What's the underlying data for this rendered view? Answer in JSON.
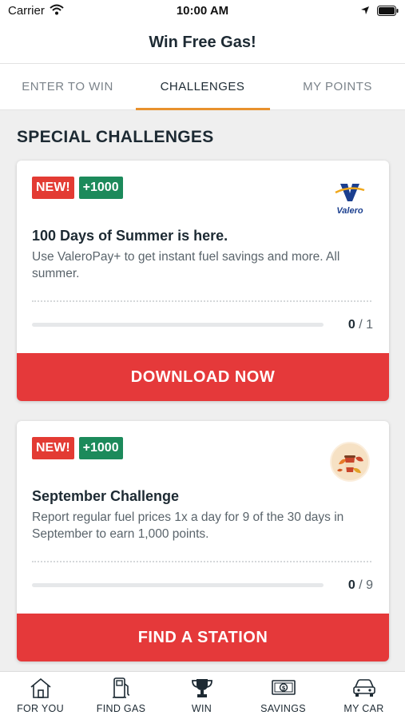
{
  "status_bar": {
    "carrier": "Carrier",
    "time": "10:00 AM"
  },
  "nav": {
    "title": "Win Free Gas!"
  },
  "tabs": [
    {
      "label": "ENTER TO WIN",
      "active": false
    },
    {
      "label": "CHALLENGES",
      "active": true
    },
    {
      "label": "MY POINTS",
      "active": false
    }
  ],
  "section": {
    "title": "SPECIAL CHALLENGES"
  },
  "challenges": [
    {
      "badge_new": "NEW!",
      "badge_points": "+1000",
      "logo_text": "Valero",
      "title": "100 Days of Summer is here.",
      "description": "Use ValeroPay+ to get instant fuel savings and more. All summer.",
      "progress_current": "0",
      "progress_total": "/ 1",
      "progress_fraction": 0,
      "cta_label": "DOWNLOAD NOW"
    },
    {
      "badge_new": "NEW!",
      "badge_points": "+1000",
      "title": "September Challenge",
      "description": "Report regular fuel prices 1x a day for 9 of the 30 days in September to earn 1,000 points.",
      "progress_current": "0",
      "progress_total": "/ 9",
      "progress_fraction": 0,
      "cta_label": "FIND A STATION"
    }
  ],
  "tabbar": [
    {
      "label": "FOR YOU",
      "icon": "house-icon"
    },
    {
      "label": "FIND GAS",
      "icon": "gas-pump-icon"
    },
    {
      "label": "WIN",
      "icon": "trophy-icon"
    },
    {
      "label": "SAVINGS",
      "icon": "dollar-bill-icon"
    },
    {
      "label": "MY CAR",
      "icon": "car-icon"
    }
  ],
  "colors": {
    "accent_tab": "#e8912d",
    "badge_new": "#e33b33",
    "badge_points": "#1c8a5b",
    "cta": "#e5393a",
    "valero_blue": "#1b3f8f"
  }
}
